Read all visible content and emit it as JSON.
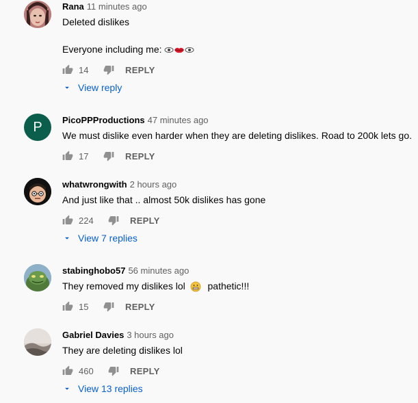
{
  "comments": [
    {
      "author": "Rana",
      "time": "11 minutes ago",
      "line1": "Deleted dislikes",
      "line2": "Everyone including me:",
      "likes": "14",
      "reply_label": "REPLY",
      "view_replies": "View reply",
      "avatar_icon": "user-photo-avatar"
    },
    {
      "author": "PicoPPProductions",
      "time": "47 minutes ago",
      "text": "We must dislike even harder when they are deleting dislikes. Road to 200k lets go.",
      "likes": "17",
      "reply_label": "REPLY",
      "avatar_letter": "P",
      "avatar_color": "#0b5e4c"
    },
    {
      "author": "whatwrongwith",
      "time": "2 hours ago",
      "text": "And just like that .. almost 50k dislikes has gone",
      "likes": "224",
      "reply_label": "REPLY",
      "view_replies": "View 7 replies",
      "avatar_icon": "cartoon-face-avatar"
    },
    {
      "author": "stabinghobo57",
      "time": "56 minutes ago",
      "text": "They removed my dislikes lol",
      "text_after": "pathetic!!!",
      "likes": "15",
      "reply_label": "REPLY",
      "avatar_icon": "green-creature-avatar"
    },
    {
      "author": "Gabriel Davies",
      "time": "3 hours ago",
      "text": "They are deleting dislikes lol",
      "likes": "460",
      "reply_label": "REPLY",
      "view_replies": "View 13 replies",
      "avatar_icon": "landscape-photo-avatar"
    }
  ],
  "colors": {
    "background": "#f9f9f9",
    "link_blue": "#065fd4",
    "meta_gray": "#606060"
  }
}
